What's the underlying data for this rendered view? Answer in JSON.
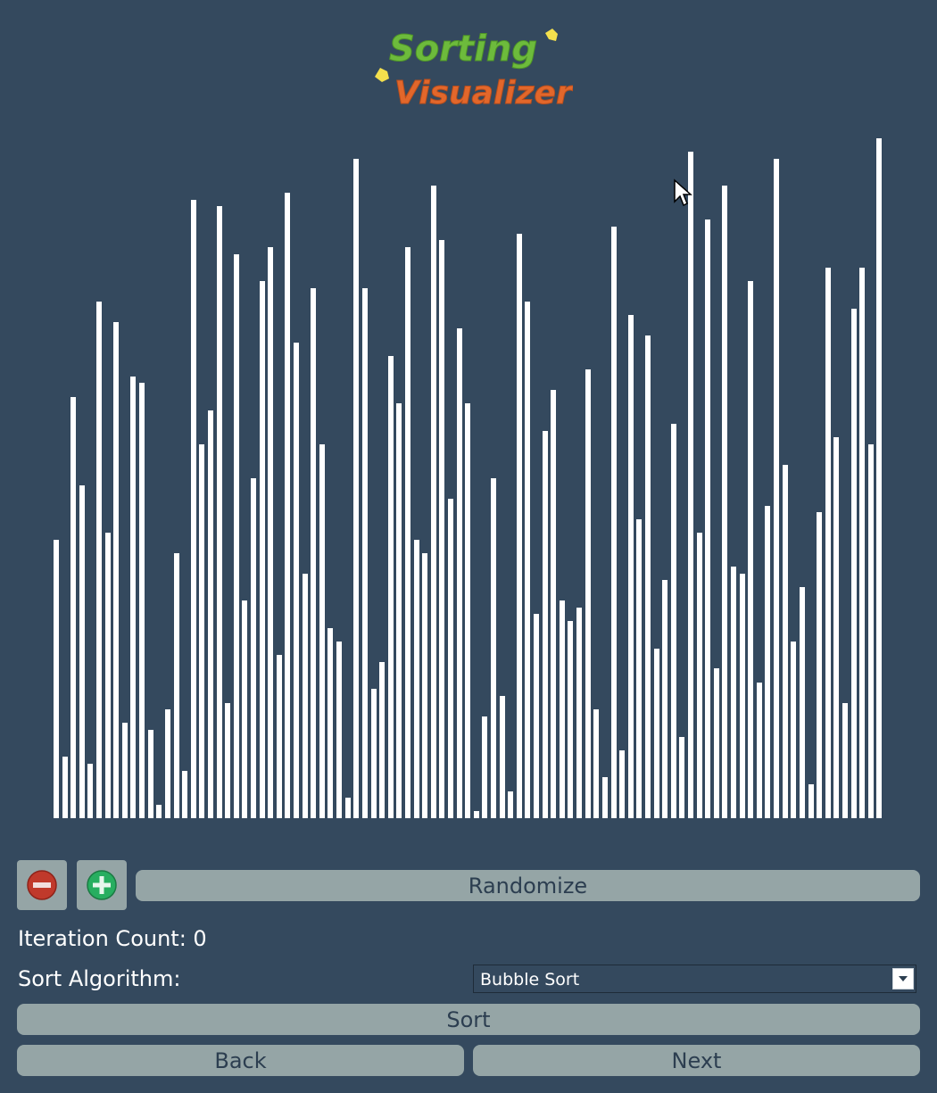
{
  "logo": {
    "line1": "Sorting",
    "line2": "Visualizer"
  },
  "controls": {
    "decrease_icon": "minus-circle-icon",
    "increase_icon": "plus-circle-icon",
    "randomize_label": "Randomize",
    "iteration_label": "Iteration Count: 0",
    "algorithm_label": "Sort Algorithm:",
    "algorithm_selected": "Bubble Sort",
    "sort_label": "Sort",
    "back_label": "Back",
    "next_label": "Next"
  },
  "colors": {
    "background": "#34495e",
    "bar": "#ffffff",
    "button": "#95a5a6",
    "button_text": "#2c3e50",
    "minus": "#c0392b",
    "plus": "#27ae60"
  },
  "chart_data": {
    "type": "bar",
    "ylim": [
      0,
      100
    ],
    "values": [
      41,
      9,
      62,
      49,
      8,
      76,
      42,
      73,
      14,
      65,
      64,
      13,
      2,
      16,
      39,
      7,
      91,
      55,
      60,
      90,
      17,
      83,
      32,
      50,
      79,
      84,
      24,
      92,
      70,
      36,
      78,
      55,
      28,
      26,
      3,
      97,
      78,
      19,
      23,
      68,
      61,
      84,
      41,
      39,
      93,
      85,
      47,
      72,
      61,
      1,
      15,
      50,
      18,
      4,
      86,
      76,
      30,
      57,
      63,
      32,
      29,
      31,
      66,
      16,
      6,
      87,
      10,
      74,
      44,
      71,
      25,
      35,
      58,
      12,
      98,
      42,
      88,
      22,
      93,
      37,
      36,
      79,
      20,
      46,
      97,
      52,
      26,
      34,
      5,
      45,
      81,
      56,
      17,
      75,
      81,
      55,
      100
    ]
  }
}
